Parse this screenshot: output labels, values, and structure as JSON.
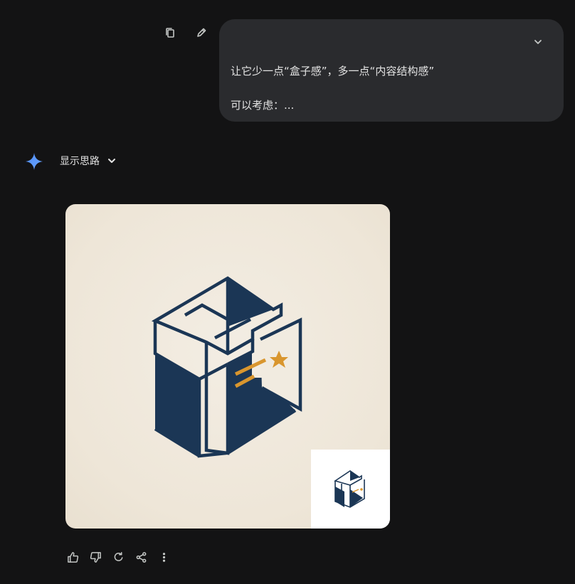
{
  "user_message": {
    "line1": "让它少一点“盒子感”，多一点“内容结构感”",
    "line2": "可以考虑：..."
  },
  "message_actions": {
    "icons": [
      "copy-icon",
      "edit-icon"
    ]
  },
  "bubble": {
    "expand_icon": "chevron-down-icon"
  },
  "model": {
    "avatar_icon": "sparkle-icon",
    "thinking_label": "显示思路",
    "thinking_icon": "chevron-down-icon"
  },
  "generated_image": {
    "type": "logo-image",
    "colors": {
      "navy": "#1b3655",
      "cream": "#f1ebe0",
      "gold": "#d9962e",
      "thumb_bg": "#ffffff"
    }
  },
  "feedback_actions": {
    "icons": [
      "thumbs-up-icon",
      "thumbs-down-icon",
      "regenerate-icon",
      "share-icon",
      "more-vert-icon"
    ]
  },
  "colors": {
    "page_bg": "#131314",
    "bubble_bg": "#2a2b2e",
    "text": "#e3e3e3",
    "icon": "#c4c7c5",
    "spark_start": "#4f8df7",
    "spark_end": "#6aa5ff"
  }
}
